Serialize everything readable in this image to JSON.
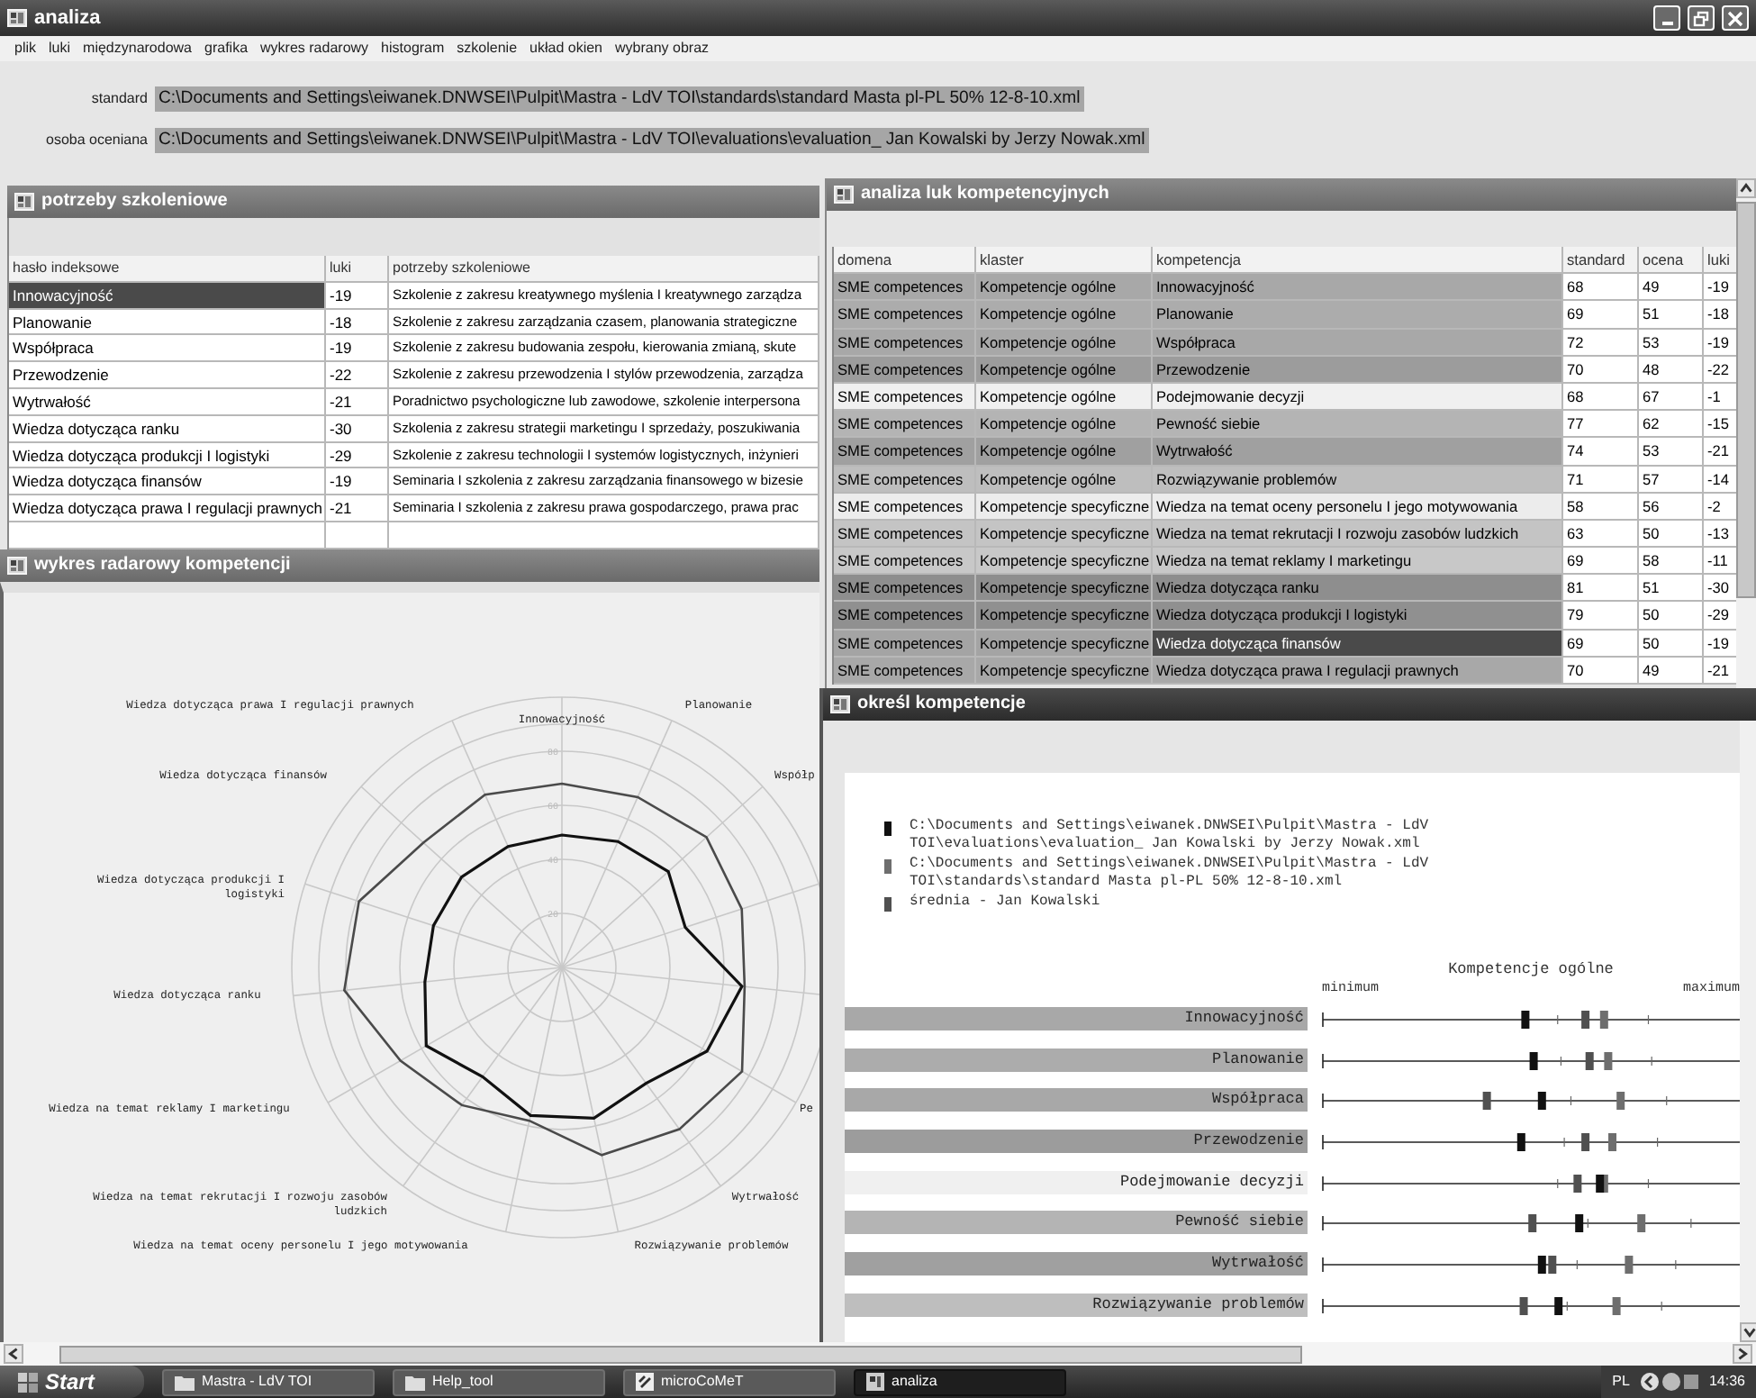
{
  "window": {
    "title": "analiza"
  },
  "menu": [
    "plik",
    "luki",
    "międzynarodowa",
    "grafika",
    "wykres radarowy",
    "histogram",
    "szkolenie",
    "układ okien",
    "wybrany obraz"
  ],
  "paths": [
    {
      "label": "standard",
      "value": "C:\\Documents and Settings\\eiwanek.DNWSEI\\Pulpit\\Mastra - LdV TOI\\standards\\standard Masta pl-PL 50% 12-8-10.xml"
    },
    {
      "label": "osoba oceniana",
      "value": "C:\\Documents and Settings\\eiwanek.DNWSEI\\Pulpit\\Mastra - LdV TOI\\evaluations\\evaluation_ Jan Kowalski by Jerzy Nowak.xml"
    }
  ],
  "training_panel": {
    "title": "potrzeby szkoleniowe",
    "columns": [
      "hasło indeksowe",
      "luki",
      "potrzeby szkoleniowe"
    ],
    "rows": [
      {
        "keyword": "Innowacyjność",
        "gap": "-19",
        "need": "Szkolenie z zakresu kreatywnego myślenia I kreatywnego zarządza",
        "selected": true
      },
      {
        "keyword": "Planowanie",
        "gap": "-18",
        "need": "Szkolenie z zakresu zarządzania czasem, planowania strategiczne",
        "selected": false
      },
      {
        "keyword": "Współpraca",
        "gap": "-19",
        "need": "Szkolenie z zakresu budowania zespołu, kierowania zmianą, skute",
        "selected": false
      },
      {
        "keyword": "Przewodzenie",
        "gap": "-22",
        "need": "Szkolenie z zakresu przewodzenia I stylów przewodzenia, zarządza",
        "selected": false
      },
      {
        "keyword": "Wytrwałość",
        "gap": "-21",
        "need": "Poradnictwo psychologiczne lub zawodowe, szkolenie interpersona",
        "selected": false
      },
      {
        "keyword": "Wiedza dotycząca ranku",
        "gap": "-30",
        "need": "Szkolenia z zakresu strategii marketingu I sprzedaży, poszukiwania",
        "selected": false
      },
      {
        "keyword": "Wiedza dotycząca produkcji I logistyki",
        "gap": "-29",
        "need": "Szkolenie z zakresu technologii I systemów logistycznych, inżynieri",
        "selected": false
      },
      {
        "keyword": "Wiedza dotycząca finansów",
        "gap": "-19",
        "need": "Seminaria I szkolenia z zakresu zarządzania finansowego w bizesie",
        "selected": false
      },
      {
        "keyword": "Wiedza dotycząca prawa I regulacji prawnych",
        "gap": "-21",
        "need": "Seminaria I szkolenia z zakresu prawa gospodarczego, prawa prac",
        "selected": false
      }
    ]
  },
  "radar_panel": {
    "title": "wykres radarowy kompetencji",
    "tick_labels": [
      "80",
      "60",
      "40",
      "20"
    ],
    "axis_labels": [
      {
        "lines": [
          "Wiedza dotycząca prawa I regulacji prawnych"
        ]
      },
      {
        "lines": [
          "Planowanie"
        ]
      },
      {
        "lines": [
          "Innowacyjność"
        ]
      },
      {
        "lines": [
          "Wiedza dotycząca finansów"
        ]
      },
      {
        "lines": [
          "Współp"
        ]
      },
      {
        "lines": [
          "Wiedza dotycząca produkcji I",
          "logistyki"
        ]
      },
      {
        "lines": [
          "Wiedza dotycząca ranku"
        ]
      },
      {
        "lines": [
          "Wiedza na temat reklamy I marketingu"
        ]
      },
      {
        "lines": [
          "Pe"
        ]
      },
      {
        "lines": [
          "Wiedza na temat rekrutacji I rozwoju zasobów",
          "ludzkich"
        ]
      },
      {
        "lines": [
          "Wytrwałość"
        ]
      },
      {
        "lines": [
          "Wiedza na temat oceny personelu I jego motywowania"
        ]
      },
      {
        "lines": [
          "Rozwiązywanie problemów"
        ]
      }
    ]
  },
  "gap_panel": {
    "title": "analiza luk kompetencyjnych",
    "columns": [
      "domena",
      "klaster",
      "kompetencja",
      "standard",
      "ocena",
      "luki"
    ],
    "rows": [
      {
        "domain": "SME competences",
        "cluster": "Kompetencje ogólne",
        "competence": "Innowacyjność",
        "standard": "68",
        "rating": "49",
        "gap": "-19",
        "color": "#a8a8a8",
        "selected": false
      },
      {
        "domain": "SME competences",
        "cluster": "Kompetencje ogólne",
        "competence": "Planowanie",
        "standard": "69",
        "rating": "51",
        "gap": "-18",
        "color": "#acacac",
        "selected": false
      },
      {
        "domain": "SME competences",
        "cluster": "Kompetencje ogólne",
        "competence": "Współpraca",
        "standard": "72",
        "rating": "53",
        "gap": "-19",
        "color": "#a8a8a8",
        "selected": false
      },
      {
        "domain": "SME competences",
        "cluster": "Kompetencje ogólne",
        "competence": "Przewodzenie",
        "standard": "70",
        "rating": "48",
        "gap": "-22",
        "color": "#9c9c9c",
        "selected": false
      },
      {
        "domain": "SME competences",
        "cluster": "Kompetencje ogólne",
        "competence": "Podejmowanie decyzji",
        "standard": "68",
        "rating": "67",
        "gap": "-1",
        "color": "#f0f0f0",
        "selected": false
      },
      {
        "domain": "SME competences",
        "cluster": "Kompetencje ogólne",
        "competence": "Pewność siebie",
        "standard": "77",
        "rating": "62",
        "gap": "-15",
        "color": "#b4b4b4",
        "selected": false
      },
      {
        "domain": "SME competences",
        "cluster": "Kompetencje ogólne",
        "competence": "Wytrwałość",
        "standard": "74",
        "rating": "53",
        "gap": "-21",
        "color": "#a0a0a0",
        "selected": false
      },
      {
        "domain": "SME competences",
        "cluster": "Kompetencje ogólne",
        "competence": "Rozwiązywanie problemów",
        "standard": "71",
        "rating": "57",
        "gap": "-14",
        "color": "#bebebe",
        "selected": false
      },
      {
        "domain": "SME competences",
        "cluster": "Kompetencje specyficzne",
        "competence": "Wiedza na temat oceny personelu I jego motywowania",
        "standard": "58",
        "rating": "56",
        "gap": "-2",
        "color": "#ececec",
        "selected": false
      },
      {
        "domain": "SME competences",
        "cluster": "Kompetencje specyficzne",
        "competence": "Wiedza na temat rekrutacji I rozwoju zasobów ludzkich",
        "standard": "63",
        "rating": "50",
        "gap": "-13",
        "color": "#c4c4c4",
        "selected": false
      },
      {
        "domain": "SME competences",
        "cluster": "Kompetencje specyficzne",
        "competence": "Wiedza na temat reklamy I marketingu",
        "standard": "69",
        "rating": "58",
        "gap": "-11",
        "color": "#c8c8c8",
        "selected": false
      },
      {
        "domain": "SME competences",
        "cluster": "Kompetencje specyficzne",
        "competence": "Wiedza dotycząca ranku",
        "standard": "81",
        "rating": "51",
        "gap": "-30",
        "color": "#8e8e8e",
        "selected": false
      },
      {
        "domain": "SME competences",
        "cluster": "Kompetencje specyficzne",
        "competence": "Wiedza dotycząca produkcji I logistyki",
        "standard": "79",
        "rating": "50",
        "gap": "-29",
        "color": "#909090",
        "selected": false
      },
      {
        "domain": "SME competences",
        "cluster": "Kompetencje specyficzne",
        "competence": "Wiedza dotycząca finansów",
        "standard": "69",
        "rating": "50",
        "gap": "-19",
        "color": "#a4a4a4",
        "selected": true
      },
      {
        "domain": "SME competences",
        "cluster": "Kompetencje specyficzne",
        "competence": "Wiedza dotycząca prawa I regulacji prawnych",
        "standard": "70",
        "rating": "49",
        "gap": "-21",
        "color": "#a8a8a8",
        "selected": false
      }
    ]
  },
  "competence_panel": {
    "title": "określ kompetencje",
    "legend": [
      {
        "text": "C:\\Documents and Settings\\eiwanek.DNWSEI\\Pulpit\\Mastra - LdV TOI\\evaluations\\evaluation_ Jan Kowalski by Jerzy Nowak.xml",
        "color": "#111111"
      },
      {
        "text": "C:\\Documents and Settings\\eiwanek.DNWSEI\\Pulpit\\Mastra - LdV TOI\\standards\\standard Masta pl-PL 50% 12-8-10.xml",
        "color": "#6e6e6e"
      },
      {
        "text": "średnia - Jan Kowalski",
        "color": "#505050"
      }
    ],
    "group_title": "Kompetencje ogólne",
    "min_label": "minimum",
    "max_label": "maximum",
    "rows": [
      {
        "label": "Innowacyjność"
      },
      {
        "label": "Planowanie"
      },
      {
        "label": "Współpraca"
      },
      {
        "label": "Przewodzenie"
      },
      {
        "label": "Podejmowanie decyzji"
      },
      {
        "label": "Pewność siebie"
      },
      {
        "label": "Wytrwałość"
      },
      {
        "label": "Rozwiązywanie problemów"
      }
    ]
  },
  "taskbar": {
    "start": "Start",
    "tasks": [
      {
        "label": "Mastra - LdV TOI",
        "kind": "folder",
        "selected": false
      },
      {
        "label": "Help_tool",
        "kind": "folder",
        "selected": false
      },
      {
        "label": "microCoMeT",
        "kind": "app",
        "selected": false
      },
      {
        "label": "analiza",
        "kind": "window",
        "selected": true
      }
    ],
    "language": "PL",
    "clock": "14:36"
  }
}
